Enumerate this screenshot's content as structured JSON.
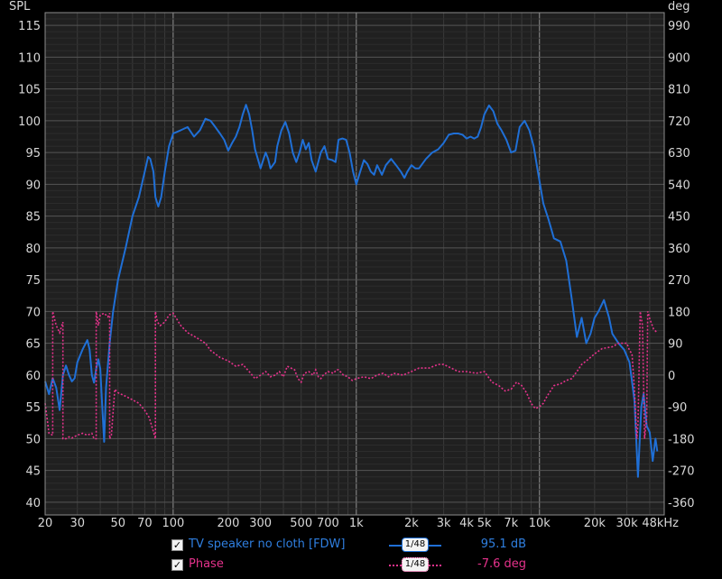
{
  "colors": {
    "spl": "#1f6fd6",
    "phase": "#e6328c",
    "spl_text": "#2f7fe0",
    "phase_text": "#e6328c",
    "grid_major": "#8c8c8c",
    "grid_minor": "#3a3a3a",
    "background": "#202020",
    "tick_text": "#d8d8d8"
  },
  "chart_data": {
    "type": "line",
    "x_scale": "log",
    "xlim": [
      20,
      48000
    ],
    "ylim_left": [
      38,
      117
    ],
    "ylim_right": [
      -396,
      1026
    ],
    "left_axis_unit": "SPL",
    "right_axis_unit": "deg",
    "x_tick_labels": [
      "20",
      "30",
      "50",
      "70",
      "100",
      "200",
      "300",
      "500",
      "700",
      "1k",
      "2k",
      "3k",
      "4k",
      "5k",
      "7k",
      "10k",
      "20k",
      "30k",
      "48kHz"
    ],
    "x_tick_values": [
      20,
      30,
      50,
      70,
      100,
      200,
      300,
      500,
      700,
      1000,
      2000,
      3000,
      4000,
      5000,
      7000,
      10000,
      20000,
      30000,
      48000
    ],
    "y_left_ticks": [
      40,
      45,
      50,
      55,
      60,
      65,
      70,
      75,
      80,
      85,
      90,
      95,
      100,
      105,
      110,
      115
    ],
    "y_right_ticks": [
      -360,
      -270,
      -180,
      -90,
      0,
      90,
      180,
      270,
      360,
      450,
      540,
      630,
      720,
      810,
      900,
      990
    ],
    "series": [
      {
        "name": "TV speaker no cloth [FDW]",
        "axis": "left",
        "points": [
          [
            20,
            59
          ],
          [
            21,
            57
          ],
          [
            22,
            59.5
          ],
          [
            23,
            58
          ],
          [
            24,
            54.5
          ],
          [
            25,
            60
          ],
          [
            26,
            61.5
          ],
          [
            27,
            60
          ],
          [
            28,
            59
          ],
          [
            29,
            59.5
          ],
          [
            30,
            62
          ],
          [
            32,
            64
          ],
          [
            34,
            65.5
          ],
          [
            35,
            64
          ],
          [
            36,
            60
          ],
          [
            37,
            58.8
          ],
          [
            38,
            61
          ],
          [
            39,
            62.5
          ],
          [
            40,
            61
          ],
          [
            41,
            55
          ],
          [
            42,
            49.5
          ],
          [
            43,
            58
          ],
          [
            45,
            65
          ],
          [
            47,
            70
          ],
          [
            50,
            75
          ],
          [
            55,
            80
          ],
          [
            60,
            85
          ],
          [
            65,
            88
          ],
          [
            70,
            92
          ],
          [
            73,
            94.3
          ],
          [
            75,
            94
          ],
          [
            78,
            92
          ],
          [
            80,
            88
          ],
          [
            83,
            86.5
          ],
          [
            86,
            88
          ],
          [
            90,
            92
          ],
          [
            95,
            96
          ],
          [
            100,
            98
          ],
          [
            110,
            98.5
          ],
          [
            120,
            99
          ],
          [
            130,
            97.5
          ],
          [
            140,
            98.5
          ],
          [
            150,
            100.3
          ],
          [
            160,
            100
          ],
          [
            170,
            99
          ],
          [
            180,
            98
          ],
          [
            190,
            97
          ],
          [
            200,
            95.3
          ],
          [
            210,
            96.5
          ],
          [
            220,
            97.5
          ],
          [
            230,
            99
          ],
          [
            240,
            101
          ],
          [
            250,
            102.5
          ],
          [
            260,
            101
          ],
          [
            270,
            98.5
          ],
          [
            280,
            95.5
          ],
          [
            290,
            94
          ],
          [
            300,
            92.5
          ],
          [
            310,
            93.8
          ],
          [
            320,
            95
          ],
          [
            330,
            94
          ],
          [
            340,
            92.5
          ],
          [
            350,
            93
          ],
          [
            360,
            93.5
          ],
          [
            370,
            96
          ],
          [
            390,
            98.5
          ],
          [
            410,
            99.8
          ],
          [
            430,
            98
          ],
          [
            450,
            95
          ],
          [
            470,
            93.5
          ],
          [
            490,
            95
          ],
          [
            510,
            97
          ],
          [
            530,
            95.5
          ],
          [
            550,
            96.5
          ],
          [
            570,
            93.8
          ],
          [
            600,
            92
          ],
          [
            640,
            95
          ],
          [
            670,
            96
          ],
          [
            700,
            94
          ],
          [
            740,
            93.8
          ],
          [
            770,
            93.5
          ],
          [
            800,
            97
          ],
          [
            840,
            97.2
          ],
          [
            880,
            97
          ],
          [
            920,
            95
          ],
          [
            960,
            92
          ],
          [
            1000,
            90
          ],
          [
            1050,
            92
          ],
          [
            1100,
            93.8
          ],
          [
            1150,
            93.2
          ],
          [
            1200,
            92
          ],
          [
            1250,
            91.5
          ],
          [
            1300,
            93
          ],
          [
            1380,
            91.5
          ],
          [
            1450,
            93
          ],
          [
            1550,
            94
          ],
          [
            1650,
            93
          ],
          [
            1750,
            92
          ],
          [
            1830,
            91
          ],
          [
            1900,
            92
          ],
          [
            2000,
            93
          ],
          [
            2100,
            92.5
          ],
          [
            2200,
            92.5
          ],
          [
            2400,
            94
          ],
          [
            2600,
            95
          ],
          [
            2800,
            95.5
          ],
          [
            3000,
            96.5
          ],
          [
            3200,
            97.8
          ],
          [
            3400,
            98
          ],
          [
            3600,
            98
          ],
          [
            3800,
            97.8
          ],
          [
            4000,
            97.2
          ],
          [
            4200,
            97.5
          ],
          [
            4400,
            97.2
          ],
          [
            4600,
            97.5
          ],
          [
            4800,
            99
          ],
          [
            5000,
            101
          ],
          [
            5300,
            102.4
          ],
          [
            5600,
            101.5
          ],
          [
            5900,
            99.5
          ],
          [
            6200,
            98.5
          ],
          [
            6600,
            97
          ],
          [
            7000,
            95
          ],
          [
            7400,
            95.3
          ],
          [
            7800,
            99
          ],
          [
            8300,
            100
          ],
          [
            8800,
            98.5
          ],
          [
            9300,
            96
          ],
          [
            9800,
            92
          ],
          [
            10500,
            87
          ],
          [
            11200,
            84.5
          ],
          [
            12000,
            81.5
          ],
          [
            13000,
            81
          ],
          [
            14000,
            78
          ],
          [
            15000,
            72
          ],
          [
            16000,
            66
          ],
          [
            17000,
            69
          ],
          [
            18000,
            65
          ],
          [
            19000,
            66.5
          ],
          [
            20000,
            69
          ],
          [
            21000,
            70
          ],
          [
            22500,
            71.8
          ],
          [
            24000,
            69
          ],
          [
            25000,
            66.5
          ],
          [
            27000,
            65
          ],
          [
            29000,
            64
          ],
          [
            31000,
            62
          ],
          [
            33000,
            56
          ],
          [
            34500,
            44
          ],
          [
            36000,
            55
          ],
          [
            37000,
            57
          ],
          [
            38500,
            52
          ],
          [
            40000,
            51
          ],
          [
            41500,
            46.5
          ],
          [
            43000,
            50
          ],
          [
            44000,
            48
          ]
        ]
      },
      {
        "name": "Phase",
        "axis": "right",
        "points": [
          [
            20,
            -80
          ],
          [
            21,
            -165
          ],
          [
            22,
            -170
          ],
          [
            22.01,
            180
          ],
          [
            23,
            140
          ],
          [
            24,
            120
          ],
          [
            25,
            150
          ],
          [
            25.01,
            -180
          ],
          [
            26,
            -180
          ],
          [
            27,
            -175
          ],
          [
            28,
            -178
          ],
          [
            30,
            -170
          ],
          [
            32,
            -165
          ],
          [
            34,
            -170
          ],
          [
            36,
            -165
          ],
          [
            37,
            -180
          ],
          [
            38,
            -180
          ],
          [
            38.01,
            180
          ],
          [
            39,
            140
          ],
          [
            40,
            170
          ],
          [
            42,
            175
          ],
          [
            44,
            165
          ],
          [
            45,
            175
          ],
          [
            45.01,
            -180
          ],
          [
            46,
            -170
          ],
          [
            48,
            -40
          ],
          [
            50,
            -50
          ],
          [
            55,
            -60
          ],
          [
            60,
            -70
          ],
          [
            65,
            -80
          ],
          [
            70,
            -100
          ],
          [
            74,
            -120
          ],
          [
            77,
            -150
          ],
          [
            80,
            -180
          ],
          [
            80.01,
            180
          ],
          [
            82,
            150
          ],
          [
            85,
            140
          ],
          [
            90,
            150
          ],
          [
            95,
            170
          ],
          [
            100,
            175
          ],
          [
            110,
            140
          ],
          [
            120,
            120
          ],
          [
            130,
            110
          ],
          [
            140,
            100
          ],
          [
            150,
            90
          ],
          [
            160,
            70
          ],
          [
            180,
            50
          ],
          [
            200,
            40
          ],
          [
            220,
            25
          ],
          [
            240,
            30
          ],
          [
            260,
            10
          ],
          [
            280,
            -10
          ],
          [
            300,
            0
          ],
          [
            320,
            10
          ],
          [
            340,
            -5
          ],
          [
            360,
            0
          ],
          [
            380,
            10
          ],
          [
            400,
            -5
          ],
          [
            420,
            25
          ],
          [
            440,
            20
          ],
          [
            460,
            15
          ],
          [
            480,
            -10
          ],
          [
            500,
            -20
          ],
          [
            520,
            5
          ],
          [
            550,
            10
          ],
          [
            580,
            0
          ],
          [
            600,
            15
          ],
          [
            620,
            -5
          ],
          [
            640,
            -10
          ],
          [
            660,
            0
          ],
          [
            700,
            10
          ],
          [
            750,
            5
          ],
          [
            780,
            15
          ],
          [
            800,
            15
          ],
          [
            850,
            0
          ],
          [
            900,
            -5
          ],
          [
            950,
            -15
          ],
          [
            1000,
            -10
          ],
          [
            1100,
            -5
          ],
          [
            1200,
            -10
          ],
          [
            1300,
            0
          ],
          [
            1400,
            5
          ],
          [
            1500,
            -5
          ],
          [
            1600,
            5
          ],
          [
            1800,
            0
          ],
          [
            2000,
            10
          ],
          [
            2200,
            20
          ],
          [
            2500,
            20
          ],
          [
            2800,
            30
          ],
          [
            3000,
            30
          ],
          [
            3300,
            20
          ],
          [
            3600,
            10
          ],
          [
            4000,
            10
          ],
          [
            4500,
            5
          ],
          [
            5000,
            10
          ],
          [
            5500,
            -20
          ],
          [
            6000,
            -30
          ],
          [
            6500,
            -45
          ],
          [
            7000,
            -40
          ],
          [
            7500,
            -20
          ],
          [
            8000,
            -30
          ],
          [
            8500,
            -50
          ],
          [
            9000,
            -80
          ],
          [
            9500,
            -95
          ],
          [
            10000,
            -90
          ],
          [
            10500,
            -80
          ],
          [
            11000,
            -60
          ],
          [
            12000,
            -30
          ],
          [
            13000,
            -25
          ],
          [
            14000,
            -15
          ],
          [
            15000,
            -10
          ],
          [
            16000,
            10
          ],
          [
            17000,
            30
          ],
          [
            18000,
            40
          ],
          [
            19000,
            50
          ],
          [
            20000,
            60
          ],
          [
            22000,
            75
          ],
          [
            25000,
            80
          ],
          [
            27000,
            90
          ],
          [
            30000,
            90
          ],
          [
            31000,
            70
          ],
          [
            32000,
            60
          ],
          [
            33000,
            -40
          ],
          [
            34000,
            -180
          ],
          [
            34500,
            -140
          ],
          [
            35500,
            180
          ],
          [
            36500,
            140
          ],
          [
            37500,
            -180
          ],
          [
            38500,
            -120
          ],
          [
            39000,
            180
          ],
          [
            40000,
            160
          ],
          [
            42000,
            130
          ],
          [
            44000,
            120
          ]
        ]
      }
    ]
  },
  "legend": {
    "rows": [
      {
        "name": "TV speaker no cloth [FDW]",
        "smoothing_num": "1",
        "smoothing_den": "48",
        "value": "95.1 dB",
        "checked": "✓"
      },
      {
        "name": "Phase",
        "smoothing_num": "1",
        "smoothing_den": "48",
        "value": "-7.6 deg",
        "checked": "✓"
      }
    ]
  }
}
